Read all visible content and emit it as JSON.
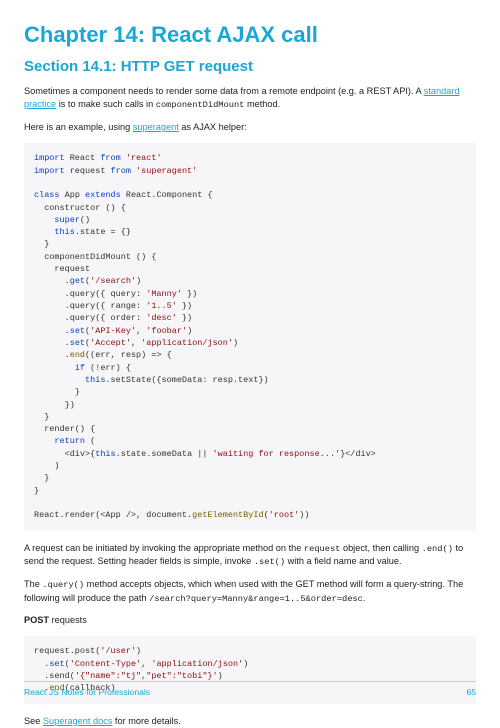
{
  "chapter_title": "Chapter 14: React AJAX call",
  "section_title": "Section 14.1: HTTP GET request",
  "para1_a": "Sometimes a component needs to render some data from a remote endpoint (e.g. a REST API). A ",
  "para1_link": "standard practice",
  "para1_b": " is to make such calls in ",
  "para1_code": "componentDidMount",
  "para1_c": " method.",
  "para2_a": "Here is an example, using ",
  "para2_link": "superagent",
  "para2_b": " as AJAX helper:",
  "code1": {
    "l1a": "import",
    "l1b": " React ",
    "l1c": "from",
    "l1d": " 'react'",
    "l2a": "import",
    "l2b": " request ",
    "l2c": "from",
    "l2d": " 'superagent'",
    "l3a": "class",
    "l3b": " App ",
    "l3c": "extends",
    "l3d": " React.Component {",
    "l4": "  constructor () {",
    "l5a": "    ",
    "l5b": "super",
    "l5c": "()",
    "l6a": "    ",
    "l6b": "this",
    "l6c": ".state = {}",
    "l7": "  }",
    "l8": "  componentDidMount () {",
    "l9": "    request",
    "l10a": "      .",
    "l10b": "get",
    "l10c": "(",
    "l10d": "'/search'",
    "l10e": ")",
    "l11a": "      .query({ query: ",
    "l11b": "'Manny'",
    "l11c": " })",
    "l12a": "      .query({ range: ",
    "l12b": "'1..5'",
    "l12c": " })",
    "l13a": "      .query({ order: ",
    "l13b": "'desc'",
    "l13c": " })",
    "l14a": "      .",
    "l14b": "set",
    "l14c": "(",
    "l14d": "'API-Key'",
    "l14e": ", ",
    "l14f": "'foobar'",
    "l14g": ")",
    "l15a": "      .",
    "l15b": "set",
    "l15c": "(",
    "l15d": "'Accept'",
    "l15e": ", ",
    "l15f": "'application/json'",
    "l15g": ")",
    "l16a": "      .",
    "l16b": "end",
    "l16c": "((err, resp) => {",
    "l17a": "        ",
    "l17b": "if",
    "l17c": " (!err) {",
    "l18a": "          ",
    "l18b": "this",
    "l18c": ".setState({someData: resp.text})",
    "l19": "        }",
    "l20": "      })",
    "l21": "  }",
    "l22": "  render() {",
    "l23a": "    ",
    "l23b": "return",
    "l23c": " (",
    "l24a": "      <div>{",
    "l24b": "this",
    "l24c": ".state.someData || ",
    "l24d": "'waiting for response...'",
    "l24e": "}</div>",
    "l25": "    )",
    "l26": "  }",
    "l27": "}",
    "l28a": "React.render(<App />, document.",
    "l28b": "getElementById",
    "l28c": "(",
    "l28d": "'root'",
    "l28e": "))"
  },
  "para3_a": "A request can be initiated by invoking the appropriate method on the ",
  "para3_c1": "request",
  "para3_b": " object, then calling ",
  "para3_c2": ".end()",
  "para3_c": " to send the request. Setting header fields is simple, invoke ",
  "para3_c3": ".set()",
  "para3_d": " with a field name and value.",
  "para4_a": "The ",
  "para4_c1": ".query()",
  "para4_b": " method accepts objects, which when used with the GET method will form a query-string. The following will produce the path ",
  "para4_c2": "/search?query=Manny&range=1..5&order=desc",
  "para4_d": ".",
  "post_label_a": "POST",
  "post_label_b": " requests",
  "code2": {
    "l1a": "request.post(",
    "l1b": "'/user'",
    "l1c": ")",
    "l2a": "  .",
    "l2b": "set",
    "l2c": "(",
    "l2d": "'Content-Type'",
    "l2e": ", ",
    "l2f": "'application/json'",
    "l2g": ")",
    "l3a": "  .send(",
    "l3b": "'{\"name\":\"tj\",\"pet\":\"tobi\"}'",
    "l3c": ")",
    "l4a": "  .",
    "l4b": "end",
    "l4c": "(callback)"
  },
  "para5_a": "See ",
  "para5_link": "Superagent docs",
  "para5_b": " for more details.",
  "footer_left": "React JS Notes for Professionals",
  "footer_right": "65"
}
